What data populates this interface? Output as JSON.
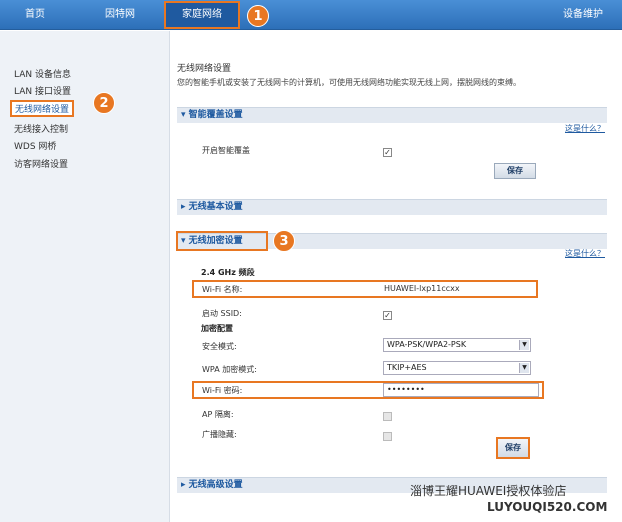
{
  "topnav": {
    "items": [
      "首页",
      "因特网",
      "家庭网络",
      "设备维护"
    ],
    "active": "家庭网络"
  },
  "callouts": [
    "1",
    "2",
    "3"
  ],
  "sidebar": {
    "items": [
      "LAN 设备信息",
      "LAN 接口设置",
      "无线网络设置",
      "无线接入控制",
      "WDS 网桥",
      "访客网络设置"
    ],
    "active": "无线网络设置"
  },
  "main": {
    "title": "无线网络设置",
    "description": "您的智能手机或安装了无线网卡的计算机，可使用无线网络功能实现无线上网，摆脱网线的束缚。",
    "sections": {
      "smart": "智能覆盖设置",
      "basic": "无线基本设置",
      "encrypt": "无线加密设置",
      "advanced": "无线高级设置"
    },
    "help_link": "这是什么？",
    "smart_enable_label": "开启智能覆盖",
    "save_label": "保存",
    "band": "2.4 GHz 频段",
    "wifi_name_label": "Wi-Fi 名称:",
    "wifi_name_value": "HUAWEI-lxp11ccxx",
    "ssid_label": "启动 SSID:",
    "encrypt_config": "加密配置",
    "security_mode_label": "安全模式:",
    "security_mode_value": "WPA-PSK/WPA2-PSK",
    "wpa_mode_label": "WPA 加密模式:",
    "wpa_mode_value": "TKIP+AES",
    "wifi_pwd_label": "Wi-Fi 密码:",
    "wifi_pwd_value": "••••••••",
    "ap_isolation_label": "AP 隔离:",
    "broadcast_hide_label": "广播隐藏:"
  },
  "watermark": {
    "line1": "淄博王耀HUAWEI授权体验店",
    "line2": "LUYOUQI520.COM"
  }
}
